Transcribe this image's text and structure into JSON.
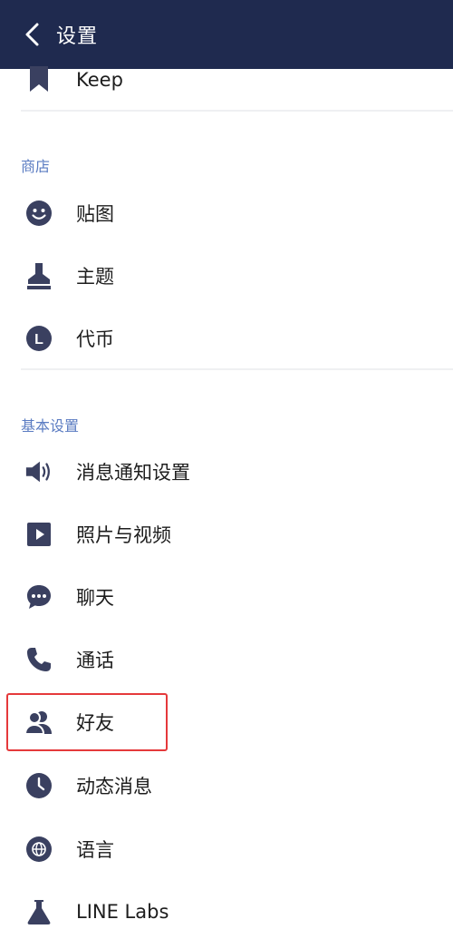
{
  "header": {
    "title": "设置"
  },
  "top_item": {
    "label": "Keep",
    "icon": "bookmark-icon"
  },
  "sections": {
    "store": {
      "title": "商店",
      "items": [
        {
          "label": "贴图",
          "icon": "smiley-icon"
        },
        {
          "label": "主题",
          "icon": "stamp-icon"
        },
        {
          "label": "代币",
          "icon": "coin-icon",
          "coin_letter": "L"
        }
      ]
    },
    "basic": {
      "title": "基本设置",
      "items": [
        {
          "label": "消息通知设置",
          "icon": "speaker-icon"
        },
        {
          "label": "照片与视频",
          "icon": "play-icon"
        },
        {
          "label": "聊天",
          "icon": "chat-bubble-icon"
        },
        {
          "label": "通话",
          "icon": "phone-icon"
        },
        {
          "label": "好友",
          "icon": "friends-icon"
        },
        {
          "label": "动态消息",
          "icon": "clock-icon"
        },
        {
          "label": "语言",
          "icon": "globe-icon"
        },
        {
          "label": "LINE Labs",
          "icon": "flask-icon"
        }
      ]
    }
  },
  "colors": {
    "header_bg": "#1f2a4f",
    "icon": "#3a4060",
    "section_title": "#5b7cc2",
    "highlight": "#e5393b"
  }
}
